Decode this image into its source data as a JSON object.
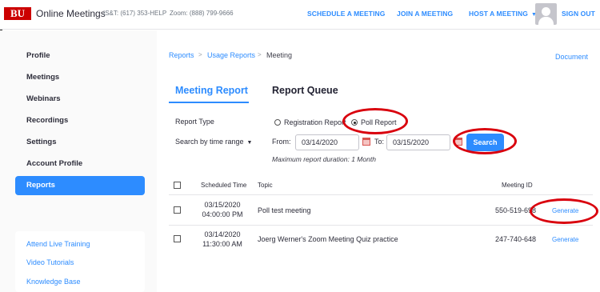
{
  "header": {
    "logo_text": "BU",
    "app_title": "Online Meetings",
    "helpline": "IS&T: (617) 353-HELP",
    "zoom_phone": "Zoom: (888) 799-9666",
    "nav": {
      "schedule": "SCHEDULE A MEETING",
      "join": "JOIN A MEETING",
      "host": "HOST A MEETING",
      "signout": "SIGN OUT"
    }
  },
  "sidebar": {
    "items": [
      {
        "label": "Profile"
      },
      {
        "label": "Meetings"
      },
      {
        "label": "Webinars"
      },
      {
        "label": "Recordings"
      },
      {
        "label": "Settings"
      },
      {
        "label": "Account Profile"
      },
      {
        "label": "Reports",
        "active": true
      }
    ],
    "links": [
      {
        "label": "Attend Live Training"
      },
      {
        "label": "Video Tutorials"
      },
      {
        "label": "Knowledge Base"
      }
    ]
  },
  "breadcrumb": {
    "items": [
      "Reports",
      "Usage Reports",
      "Meeting"
    ],
    "separator": ">"
  },
  "document_link": "Document",
  "tabs": [
    {
      "label": "Meeting Report",
      "active": true
    },
    {
      "label": "Report Queue",
      "active": false
    }
  ],
  "form": {
    "report_type_label": "Report Type",
    "options": [
      {
        "label": "Registration Report",
        "checked": false
      },
      {
        "label": "Poll Report",
        "checked": true
      }
    ],
    "time_range_label": "Search by time range",
    "from_label": "From:",
    "from_value": "03/14/2020",
    "to_label": "To:",
    "to_value": "03/15/2020",
    "search_label": "Search",
    "note": "Maximum report duration: 1 Month"
  },
  "table": {
    "headers": {
      "scheduled": "Scheduled Time",
      "topic": "Topic",
      "meeting_id": "Meeting ID"
    },
    "rows": [
      {
        "date": "03/15/2020",
        "time": "04:00:00 PM",
        "topic": "Poll test meeting",
        "meeting_id": "550-519-698",
        "action": "Generate"
      },
      {
        "date": "03/14/2020",
        "time": "11:30:00 AM",
        "topic": "Joerg Werner's Zoom Meeting Quiz practice",
        "meeting_id": "247-740-648",
        "action": "Generate"
      }
    ]
  },
  "colors": {
    "accent": "#2d8cff",
    "highlight_oval": "#d9000d",
    "bu_red": "#cc0000"
  }
}
